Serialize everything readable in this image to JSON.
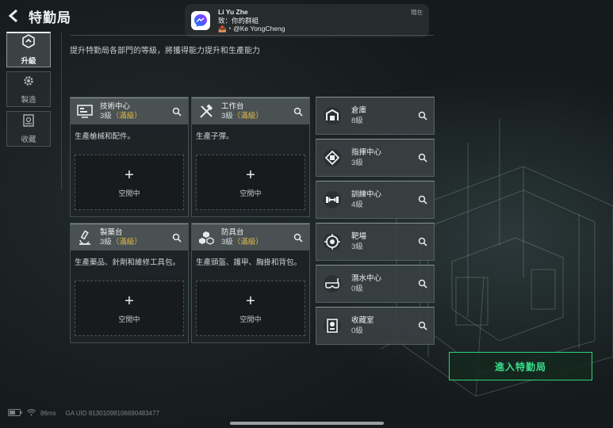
{
  "header": {
    "title": "特勤局",
    "back_icon": "chevron-left-icon"
  },
  "notification": {
    "app_icon": "messenger-icon",
    "sender": "Li Yu Zhe",
    "line2": "致：你的群組",
    "line3": "📤・@Ke YongCheng",
    "time": "現在"
  },
  "side_tabs": [
    {
      "label": "升級",
      "icon": "upgrade-icon",
      "active": true
    },
    {
      "label": "製造",
      "icon": "gear-icon",
      "active": false
    },
    {
      "label": "收藏",
      "icon": "collection-icon",
      "active": false
    }
  ],
  "subtitle": "提升特勤局各部門的等級，將獲得能力提升和生產能力",
  "cards": [
    {
      "name": "技術中心",
      "level": "3級",
      "maxed": "（滿級）",
      "desc": "生產槍械和配件。",
      "slot": "空閒中",
      "icon": "computer-icon"
    },
    {
      "name": "工作台",
      "level": "3級",
      "maxed": "（滿級）",
      "desc": "生產子彈。",
      "slot": "空閒中",
      "icon": "tools-icon"
    },
    {
      "name": "製藥台",
      "level": "3級",
      "maxed": "（滿級）",
      "desc": "生產藥品、針劑和維修工具包。",
      "slot": "空閒中",
      "icon": "microscope-icon"
    },
    {
      "name": "防具台",
      "level": "3級",
      "maxed": "（滿級）",
      "desc": "生產頭盔、護甲、胸掛和背包。",
      "slot": "空閒中",
      "icon": "armor-boxes-icon"
    }
  ],
  "facilities": [
    {
      "name": "倉庫",
      "level": "8級",
      "icon": "warehouse-icon"
    },
    {
      "name": "指揮中心",
      "level": "3級",
      "icon": "command-chip-icon"
    },
    {
      "name": "訓練中心",
      "level": "4級",
      "icon": "dumbbell-icon"
    },
    {
      "name": "靶場",
      "level": "3級",
      "icon": "target-icon"
    },
    {
      "name": "潛水中心",
      "level": "0級",
      "icon": "diving-mask-icon"
    },
    {
      "name": "收藏室",
      "level": "0級",
      "icon": "trophy-case-icon"
    }
  ],
  "enter_button": "進入特勤局",
  "status": {
    "ping": "86ms",
    "uid": "GA UID 8130109810669048347​7"
  },
  "colors": {
    "accent_green": "#39e08a",
    "maxed_gold": "#e0b84a",
    "card_header": "#4a5152"
  }
}
